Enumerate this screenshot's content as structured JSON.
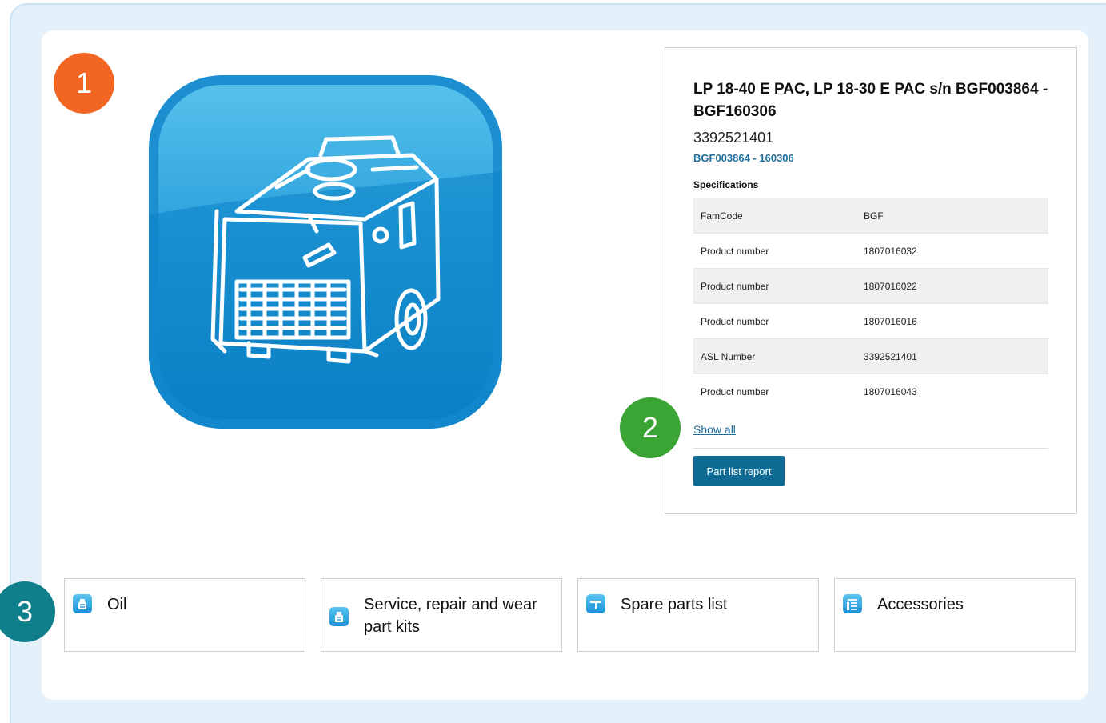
{
  "markers": [
    "1",
    "2",
    "3"
  ],
  "product": {
    "title": "LP 18-40 E PAC, LP 18-30 E PAC s/n BGF003864 - BGF160306",
    "code": "3392521401",
    "serial_range": "BGF003864 - 160306",
    "image_icon": "power-pack-icon"
  },
  "specifications": {
    "heading": "Specifications",
    "rows": [
      {
        "key": "FamCode",
        "value": "BGF"
      },
      {
        "key": "Product number",
        "value": "1807016032"
      },
      {
        "key": "Product number",
        "value": "1807016022"
      },
      {
        "key": "Product number",
        "value": "1807016016"
      },
      {
        "key": "ASL Number",
        "value": "3392521401"
      },
      {
        "key": "Product number",
        "value": "1807016043"
      }
    ],
    "show_all": "Show all",
    "report_button": "Part list report"
  },
  "categories": [
    {
      "label": "Oil",
      "icon": "oil-icon"
    },
    {
      "label": "Service, repair and wear part kits",
      "icon": "service-kit-icon"
    },
    {
      "label": "Spare parts list",
      "icon": "spare-parts-icon"
    },
    {
      "label": "Accessories",
      "icon": "accessories-icon"
    }
  ],
  "colors": {
    "frame_bg": "#e4f1fb",
    "marker_1": "#f26522",
    "marker_2": "#3aa535",
    "marker_3": "#107f8c",
    "primary_button": "#0f6b93",
    "link": "#1f6d9b"
  }
}
